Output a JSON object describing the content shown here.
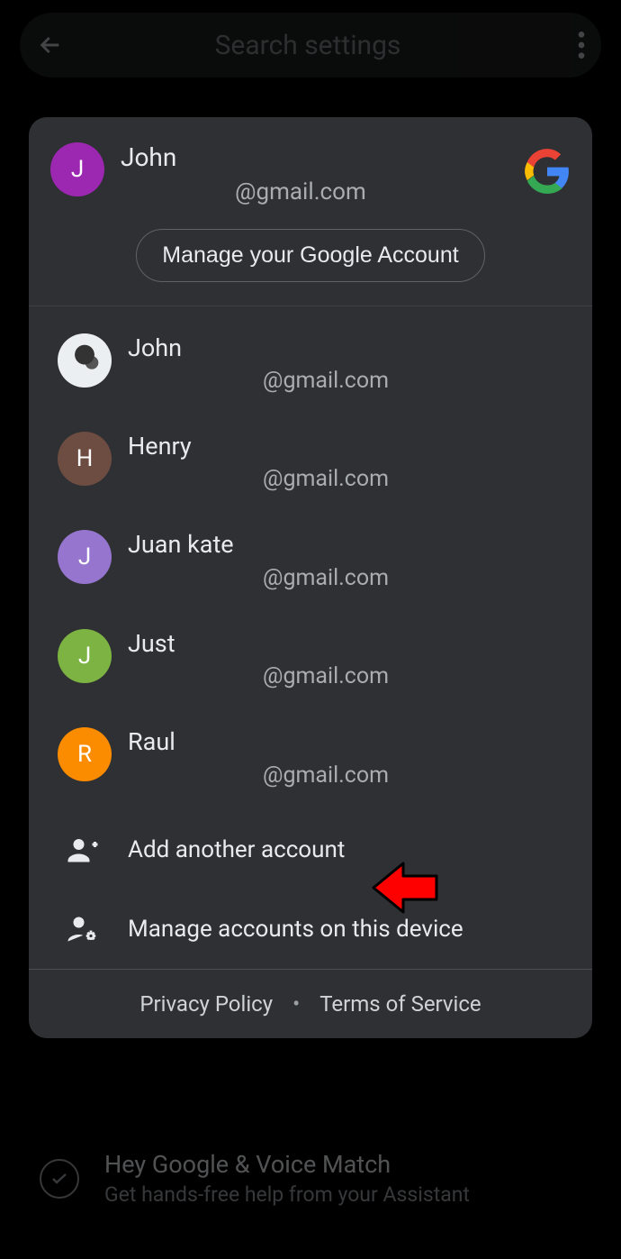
{
  "search": {
    "placeholder": "Search settings"
  },
  "primary": {
    "name": "John",
    "email": "@gmail.com",
    "initial": "J",
    "manage_label": "Manage your Google Account"
  },
  "accounts": [
    {
      "name": "John",
      "email": "@gmail.com",
      "initial": "",
      "avatar_class": "img"
    },
    {
      "name": "Henry",
      "email": "@gmail.com",
      "initial": "H",
      "avatar_class": "brown"
    },
    {
      "name": "Juan kate",
      "email": "@gmail.com",
      "initial": "J",
      "avatar_class": "lpurple"
    },
    {
      "name": "Just",
      "email": "@gmail.com",
      "initial": "J",
      "avatar_class": "green"
    },
    {
      "name": "Raul",
      "email": "@gmail.com",
      "initial": "R",
      "avatar_class": "orange"
    }
  ],
  "actions": {
    "add": "Add another account",
    "manage": "Manage accounts on this device"
  },
  "footer": {
    "privacy": "Privacy Policy",
    "terms": "Terms of Service"
  },
  "bg": {
    "title": "Hey Google & Voice Match",
    "sub": "Get hands-free help from your Assistant"
  }
}
